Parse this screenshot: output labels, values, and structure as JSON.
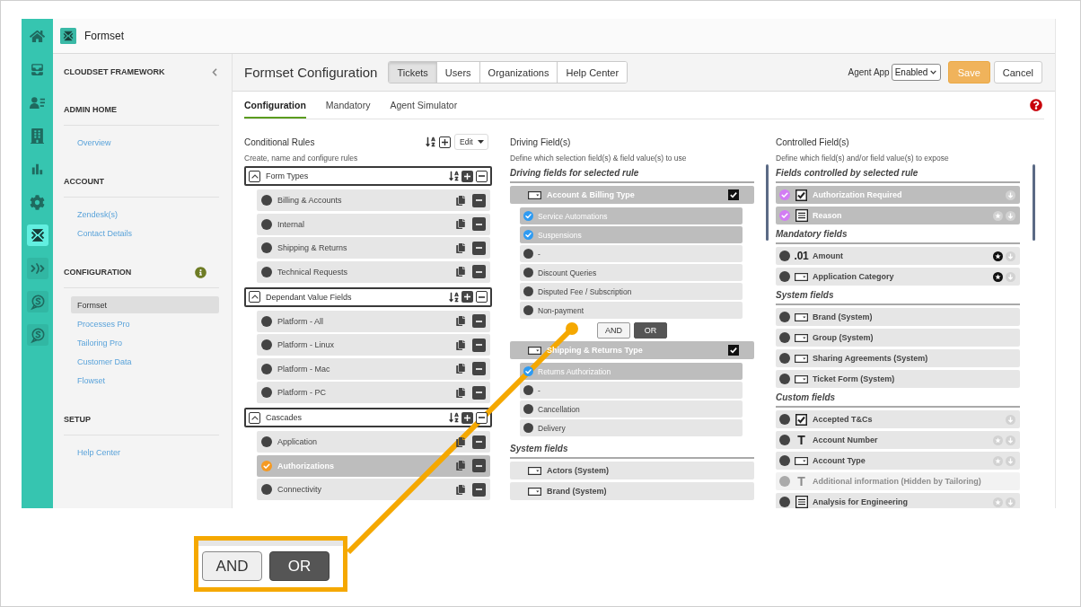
{
  "nav_rail": [
    {
      "kind": "nav",
      "selected": false
    },
    {
      "kind": "nav",
      "selected": false
    },
    {
      "kind": "nav",
      "selected": false
    },
    {
      "kind": "nav",
      "selected": false
    },
    {
      "kind": "nav",
      "selected": false
    },
    {
      "kind": "nav",
      "selected": false
    },
    {
      "kind": "app",
      "selected": true
    },
    {
      "kind": "app",
      "selected": false
    },
    {
      "kind": "app",
      "selected": false
    },
    {
      "kind": "app",
      "selected": false
    }
  ],
  "top_bar": {
    "title": "Formset"
  },
  "sidebar": {
    "title": "CLOUDSET FRAMEWORK",
    "sections": [
      {
        "heading": "ADMIN HOME",
        "info": false,
        "links": [
          {
            "label": "Overview",
            "selected": false
          }
        ]
      },
      {
        "heading": "ACCOUNT",
        "info": false,
        "links": [
          {
            "label": "Zendesk(s)",
            "selected": false
          },
          {
            "label": "Contact Details",
            "selected": false
          }
        ]
      },
      {
        "heading": "CONFIGURATION",
        "info": true,
        "links": [
          {
            "label": "Formset",
            "selected": true
          },
          {
            "label": "Processes Pro",
            "selected": false
          },
          {
            "label": "Tailoring Pro",
            "selected": false
          },
          {
            "label": "Customer Data",
            "selected": false
          },
          {
            "label": "Flowset",
            "selected": false
          }
        ]
      },
      {
        "heading": "SETUP",
        "info": false,
        "links": [
          {
            "label": "Help Center",
            "selected": false
          }
        ]
      }
    ]
  },
  "header": {
    "title": "Formset Configuration",
    "tabs": [
      {
        "label": "Tickets",
        "selected": true
      },
      {
        "label": "Users",
        "selected": false
      },
      {
        "label": "Organizations",
        "selected": false
      },
      {
        "label": "Help Center",
        "selected": false
      }
    ],
    "agent_app": {
      "label": "Agent App",
      "value": "Enabled"
    },
    "buttons": [
      {
        "label": "Save",
        "kind": "primary"
      },
      {
        "label": "Cancel",
        "kind": "secondary"
      }
    ]
  },
  "subtabs": [
    {
      "label": "Configuration",
      "selected": true
    },
    {
      "label": "Mandatory",
      "selected": false
    },
    {
      "label": "Agent Simulator",
      "selected": false
    }
  ],
  "conditional_rules": {
    "title": "Conditional Rules",
    "menu": "Edit",
    "subtitle": "Create, name and configure rules",
    "groups": [
      {
        "name": "Form Types",
        "expanded": true,
        "rules": [
          {
            "label": "Billing & Accounts",
            "selected": false
          },
          {
            "label": "Internal",
            "selected": false
          },
          {
            "label": "Shipping & Returns",
            "selected": false
          },
          {
            "label": "Technical Requests",
            "selected": false
          }
        ]
      },
      {
        "name": "Dependant Value Fields",
        "expanded": true,
        "rules": [
          {
            "label": "Platform - All",
            "selected": false
          },
          {
            "label": "Platform - Linux",
            "selected": false
          },
          {
            "label": "Platform - Mac",
            "selected": false
          },
          {
            "label": "Platform - PC",
            "selected": false
          }
        ]
      },
      {
        "name": "Cascades",
        "expanded": true,
        "rules": [
          {
            "label": "Application",
            "selected": false
          },
          {
            "label": "Authorizations",
            "selected": true
          },
          {
            "label": "Connectivity",
            "selected": false
          }
        ]
      }
    ]
  },
  "driving_fields": {
    "title": "Driving Field(s)",
    "subtitle": "Define which selection field(s) & field value(s) to use",
    "sections": [
      {
        "heading": "Driving fields for selected rule",
        "kind": "chosen",
        "fields": [
          {
            "label": "Account & Billing Type",
            "checked": true,
            "values": [
              {
                "label": "Service Automations",
                "selected": true
              },
              {
                "label": "Suspensions",
                "selected": true
              },
              {
                "label": "-",
                "selected": false
              },
              {
                "label": "Discount Queries",
                "selected": false
              },
              {
                "label": "Disputed Fee / Subscription",
                "selected": false
              },
              {
                "label": "Non-payment",
                "selected": false
              }
            ],
            "join": [
              {
                "label": "AND",
                "selected": false
              },
              {
                "label": "OR",
                "selected": true
              }
            ]
          },
          {
            "label": "Shipping & Returns Type",
            "checked": true,
            "values": [
              {
                "label": "Returns Authorization",
                "selected": true
              },
              {
                "label": "-",
                "selected": false
              },
              {
                "label": "Cancellation",
                "selected": false
              },
              {
                "label": "Delivery",
                "selected": false
              }
            ]
          }
        ]
      },
      {
        "heading": "System fields",
        "kind": "available",
        "fields": [
          {
            "label": "Actors (System)"
          },
          {
            "label": "Brand (System)"
          }
        ]
      }
    ]
  },
  "controlled_fields": {
    "title": "Controlled Field(s)",
    "subtitle": "Define which field(s) and/or field value(s) to expose",
    "sections": [
      {
        "heading": "Fields controlled by selected rule",
        "fields": [
          {
            "label": "Authorization Required",
            "kind": "checkbox",
            "selected": true,
            "disabled": false,
            "reorder": true
          },
          {
            "label": "Reason",
            "kind": "textarea",
            "selected": true,
            "disabled": false,
            "mandatory": false,
            "reorder": true
          }
        ]
      },
      {
        "heading": "Mandatory fields",
        "fields": [
          {
            "label": "Amount",
            "kind": "decimal",
            "glyph": ".01",
            "selected": false,
            "disabled": false,
            "mandatory": true,
            "reorder": true
          },
          {
            "label": "Application Category",
            "kind": "dropdown",
            "selected": false,
            "disabled": false,
            "mandatory": true,
            "reorder": true
          }
        ]
      },
      {
        "heading": "System fields",
        "fields": [
          {
            "label": "Brand (System)",
            "kind": "dropdown",
            "selected": false,
            "disabled": false,
            "reorder": false
          },
          {
            "label": "Group (System)",
            "kind": "dropdown",
            "selected": false,
            "disabled": false,
            "reorder": false
          },
          {
            "label": "Sharing Agreements (System)",
            "kind": "dropdown",
            "selected": false,
            "disabled": false,
            "reorder": false
          },
          {
            "label": "Ticket Form (System)",
            "kind": "dropdown",
            "selected": false,
            "disabled": false,
            "reorder": false
          }
        ]
      },
      {
        "heading": "Custom fields",
        "fields": [
          {
            "label": "Accepted T&Cs",
            "kind": "checkbox",
            "selected": false,
            "disabled": false,
            "reorder": true
          },
          {
            "label": "Account Number",
            "kind": "text",
            "glyph": "T",
            "selected": false,
            "disabled": false,
            "mandatory": false,
            "reorder": true
          },
          {
            "label": "Account Type",
            "kind": "dropdown",
            "selected": false,
            "disabled": false,
            "mandatory": false,
            "reorder": true
          },
          {
            "label": "Additional information (Hidden by Tailoring)",
            "kind": "text",
            "glyph": "T",
            "selected": false,
            "disabled": true,
            "reorder": false
          },
          {
            "label": "Analysis for Engineering",
            "kind": "textarea",
            "selected": false,
            "disabled": false,
            "mandatory": false,
            "reorder": true
          }
        ]
      }
    ]
  },
  "callout": {
    "buttons": [
      {
        "label": "AND",
        "selected": false
      },
      {
        "label": "OR",
        "selected": true
      }
    ]
  }
}
